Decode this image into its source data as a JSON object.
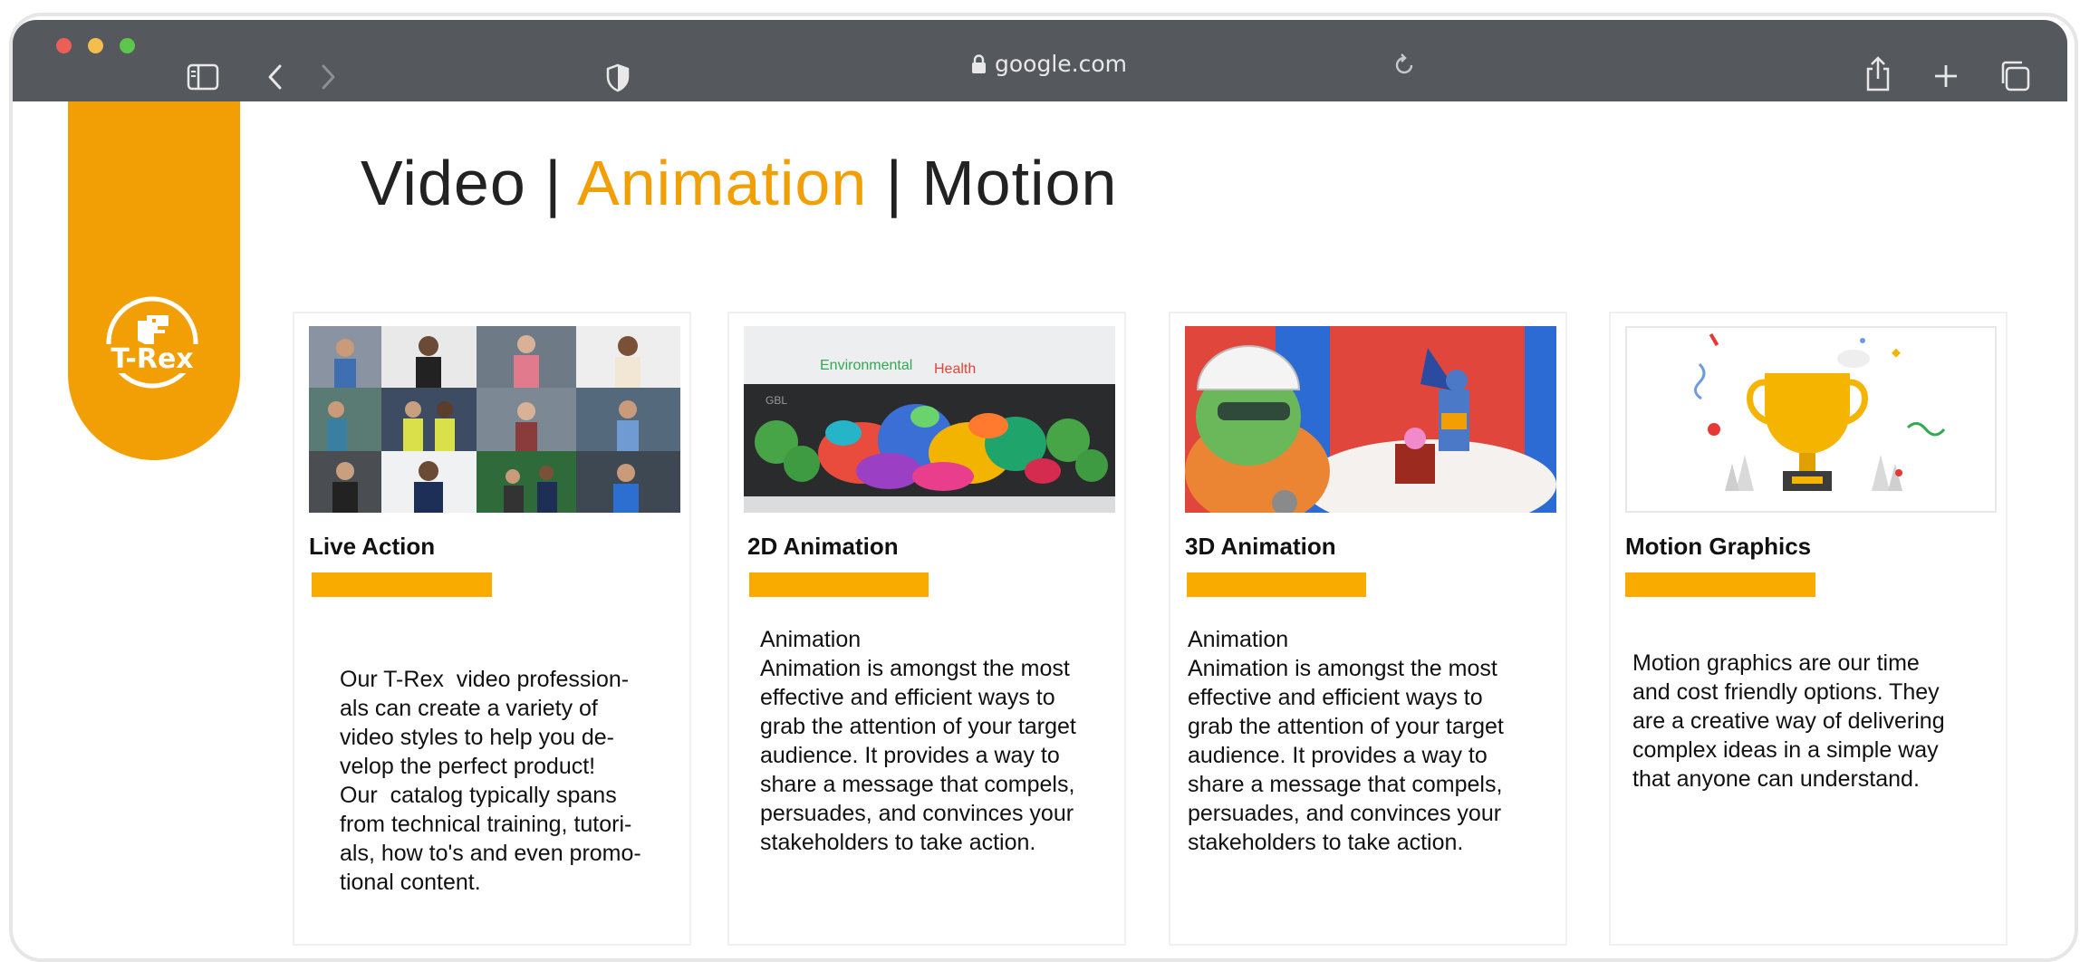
{
  "browser": {
    "url": "google.com",
    "icons": [
      "sidebar-icon",
      "back-icon",
      "forward-icon",
      "shield-icon",
      "lock-icon",
      "reload-icon",
      "share-icon",
      "new-tab-icon",
      "tabs-overview-icon"
    ]
  },
  "brand": {
    "logo_text": "T-Rex",
    "accent": "#f29f05",
    "bar_color": "#f9ab00"
  },
  "page": {
    "title_part1": "Video | ",
    "title_accent": "Animation",
    "title_part3": " | Motion"
  },
  "thumbs": {
    "env_label": "Environmental",
    "health_label": "Health",
    "gbl_label": "GBL"
  },
  "cards": [
    {
      "title": "Live Action",
      "lines": [
        "Our T-Rex  video profession-",
        "als can create a variety of",
        "video styles to help you de-",
        "velop the perfect product!",
        "Our  catalog typically spans",
        "from technical training, tutori-",
        "als, how to's and even promo-",
        "tional content."
      ]
    },
    {
      "title": "2D Animation",
      "lines": [
        "Animation",
        "Animation is amongst the most",
        "effective and efficient ways to",
        "grab the attention of your target",
        "audience. It provides a way to",
        "share a message that compels,",
        "persuades, and convinces your",
        "stakeholders to take action."
      ]
    },
    {
      "title": "3D Animation",
      "lines": [
        "Animation",
        "Animation is amongst the most",
        "effective and efficient ways to",
        "grab the attention of your target",
        "audience. It provides a way to",
        "share a message that compels,",
        "persuades, and convinces your",
        "stakeholders to take action."
      ]
    },
    {
      "title": "Motion Graphics",
      "lines": [
        "Motion graphics are our time",
        "and cost friendly options. They",
        "are a creative way of delivering",
        "complex ideas in a simple way",
        "that anyone can understand."
      ]
    }
  ]
}
